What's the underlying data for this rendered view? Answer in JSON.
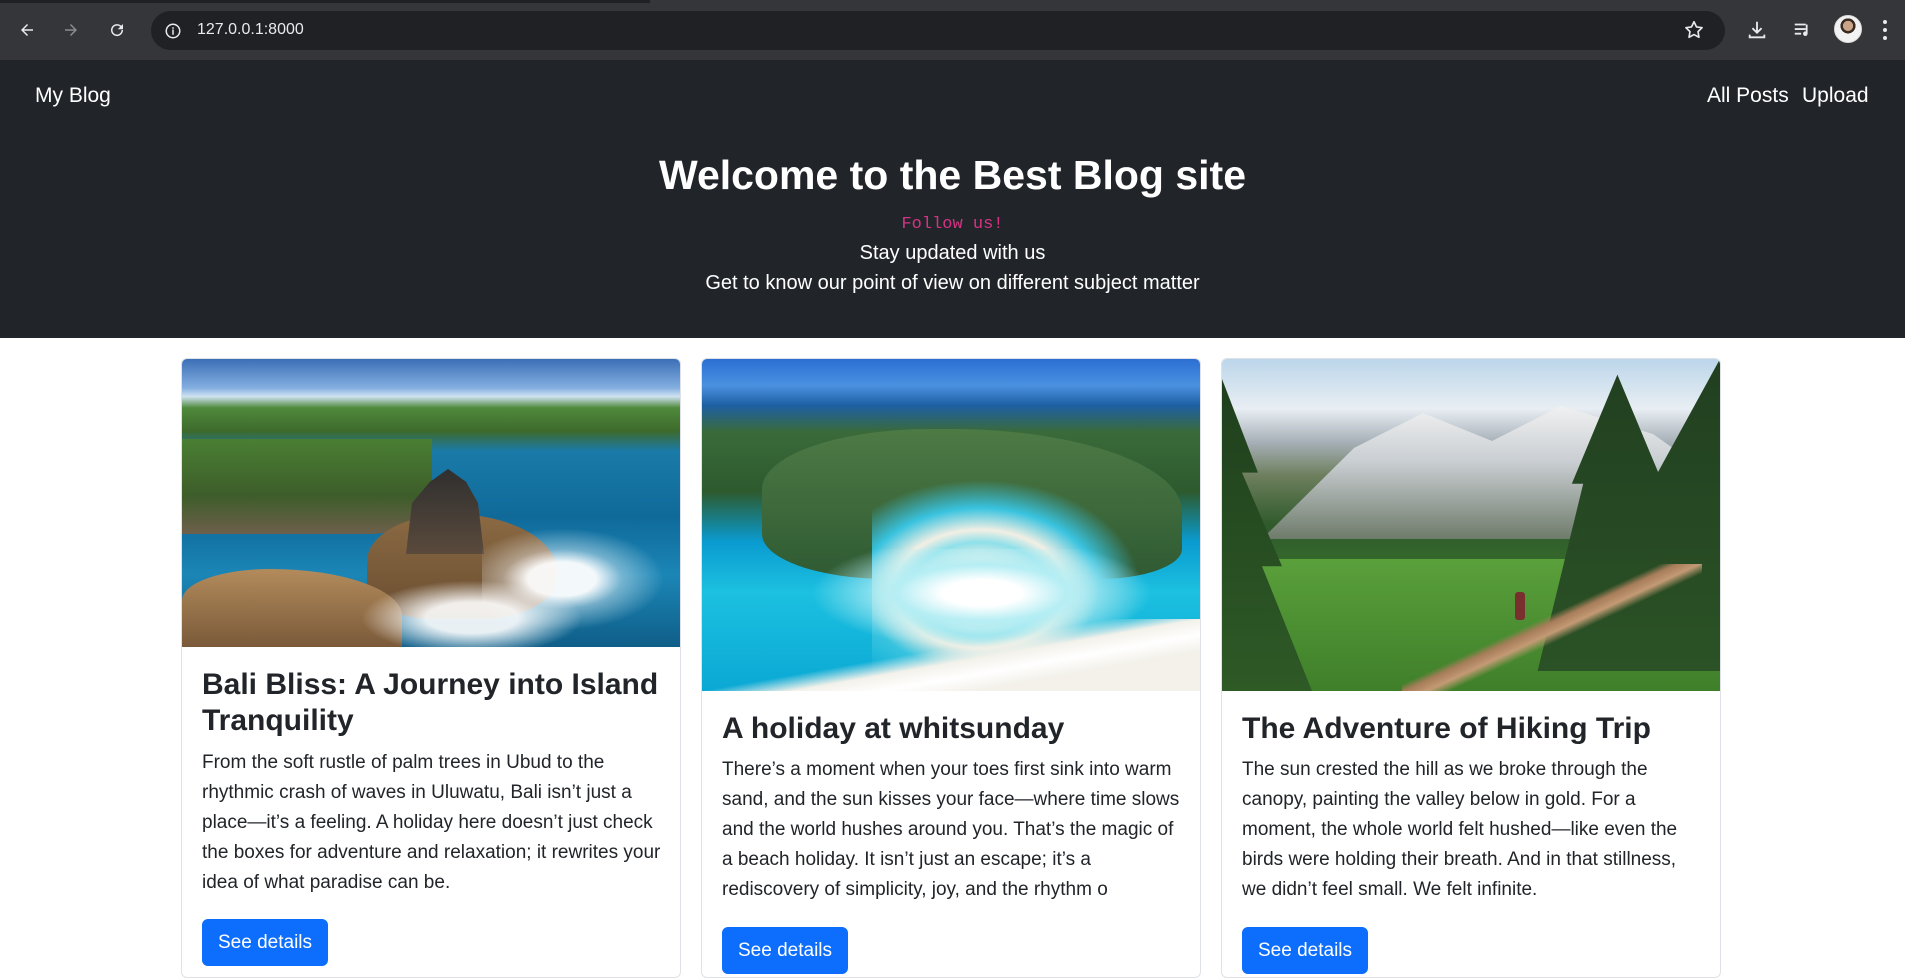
{
  "browser": {
    "url": "127.0.0.1:8000",
    "icons": {
      "back": "arrow-left-icon",
      "forward": "arrow-right-icon",
      "reload": "reload-icon",
      "site_info": "info-icon",
      "bookmark": "star-icon",
      "downloads": "download-icon",
      "media": "playlist-icon",
      "profile": "avatar",
      "menu": "kebab-menu-icon"
    }
  },
  "navbar": {
    "brand": "My Blog",
    "links": [
      "All Posts",
      "Upload"
    ]
  },
  "hero": {
    "title": "Welcome to the Best Blog site",
    "tagline": "Follow us!",
    "line1": "Stay updated with us",
    "line2": "Get to know our point of view on different subject matter"
  },
  "posts": [
    {
      "title": "Bali Bliss: A Journey into Island Tranquility",
      "excerpt": "From the soft rustle of palm trees in Ubud to the rhythmic crash of waves in Uluwatu, Bali isn’t just a place—it’s a feeling. A holiday here doesn’t just check the boxes for adventure and relaxation; it rewrites your idea of what paradise can be.",
      "button": "See details"
    },
    {
      "title": "A holiday at whitsunday",
      "excerpt": "There’s a moment when your toes first sink into warm sand, and the sun kisses your face—where time slows and the world hushes around you. That’s the magic of a beach holiday. It isn’t just an escape; it’s a rediscovery of simplicity, joy, and the rhythm o",
      "button": "See details"
    },
    {
      "title": "The Adventure of Hiking Trip",
      "excerpt": "The sun crested the hill as we broke through the canopy, painting the valley below in gold. For a moment, the whole world felt hushed—like even the birds were holding their breath. And in that stillness, we didn’t feel small. We felt infinite.",
      "button": "See details"
    }
  ],
  "colors": {
    "navbar_bg": "#212529",
    "accent_button": "#0d6efd",
    "tagline": "#d63384"
  }
}
